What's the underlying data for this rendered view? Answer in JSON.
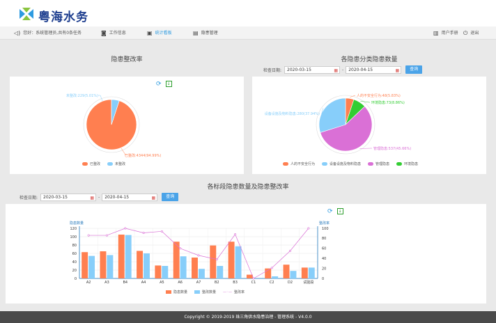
{
  "header": {
    "logo_text": "粤海水务"
  },
  "nav": {
    "greeting": "您好：系统管理员,共有0条任务",
    "work_info": "工作信息",
    "stats": "统计看板",
    "hazard_mgmt": "隐患管理",
    "user_manual": "用户手册",
    "logout": "退出"
  },
  "rectify_rate": {
    "title": "隐患整改率",
    "slice_labels": [
      "未整改:229(5.01%)",
      "已整改:4344(94.99%)"
    ],
    "legend": [
      "已整改",
      "未整改"
    ]
  },
  "category_count": {
    "title": "各隐患分类隐患数量",
    "date_label": "检查日期:",
    "date_from": "2020-03-15",
    "date_to": "2020-04-15",
    "query": "查询",
    "slice_labels": [
      "人的不安全行为:48(5.83%)",
      "环境隐患:73(8.86%)",
      "管理隐患:537(45.66%)",
      "设备设施及物料隐患:280(37.94%)"
    ],
    "legend": [
      "人的不安全行为",
      "设备设施及物料隐患",
      "管理隐患",
      "环境隐患"
    ]
  },
  "section_chart": {
    "title": "各标段隐患数量及隐患整改率",
    "date_label": "检查日期:",
    "date_from": "2020-03-15",
    "date_to": "2020-04-15",
    "query": "查询",
    "left_axis": "隐患数量",
    "right_axis": "整改率",
    "legend": [
      "隐患数量",
      "整改数量",
      "整改率"
    ]
  },
  "footer": {
    "text": "Copyright © 2019-2019 珠三角供水隐患治理 - 管理系统 - V4.0.0"
  },
  "colors": {
    "orange": "#ff7f50",
    "lightblue": "#87cefa",
    "purple": "#da70d6",
    "green": "#32cd32",
    "accent": "#2e9be0"
  },
  "chart_data": [
    {
      "type": "pie",
      "labels": [
        "已整改",
        "未整改"
      ],
      "values": [
        4344,
        229
      ],
      "percents": [
        94.99,
        5.01
      ],
      "colors": [
        "#ff7f50",
        "#87cefa"
      ]
    },
    {
      "type": "pie",
      "labels": [
        "人的不安全行为",
        "设备设施及物料隐患",
        "管理隐患",
        "环境隐患"
      ],
      "values": [
        48,
        280,
        537,
        73
      ],
      "percents": [
        5.83,
        37.94,
        45.66,
        8.86
      ],
      "colors": [
        "#ff7f50",
        "#87cefa",
        "#da70d6",
        "#32cd32"
      ]
    },
    {
      "type": "bar",
      "categories": [
        "A2",
        "A3",
        "B4",
        "A4",
        "A5",
        "A6",
        "A7",
        "B2",
        "B3",
        "C1",
        "C2",
        "D2",
        "试验段"
      ],
      "series": [
        {
          "name": "隐患数量",
          "values": [
            63,
            65,
            105,
            66,
            31,
            88,
            50,
            79,
            88,
            9,
            24,
            33,
            26
          ],
          "color": "#ff7f50"
        },
        {
          "name": "整改数量",
          "values": [
            54,
            56,
            104,
            60,
            30,
            53,
            23,
            30,
            77,
            0,
            5,
            18,
            26
          ],
          "color": "#87cefa"
        },
        {
          "name": "整改率",
          "values": [
            86,
            86,
            100,
            91,
            94,
            60,
            46,
            38,
            88,
            0,
            21,
            55,
            100
          ],
          "color": "#da70d6",
          "axis": "right"
        }
      ],
      "ylabel_left": "隐患数量",
      "ylabel_right": "整改率",
      "ylim_left": [
        0,
        120
      ],
      "ylim_right": [
        0,
        100
      ],
      "yticks_left": [
        0,
        20,
        40,
        60,
        80,
        100,
        120
      ],
      "yticks_right": [
        0,
        20,
        40,
        60,
        80,
        100
      ],
      "grid": true,
      "legend_position": "bottom"
    }
  ]
}
